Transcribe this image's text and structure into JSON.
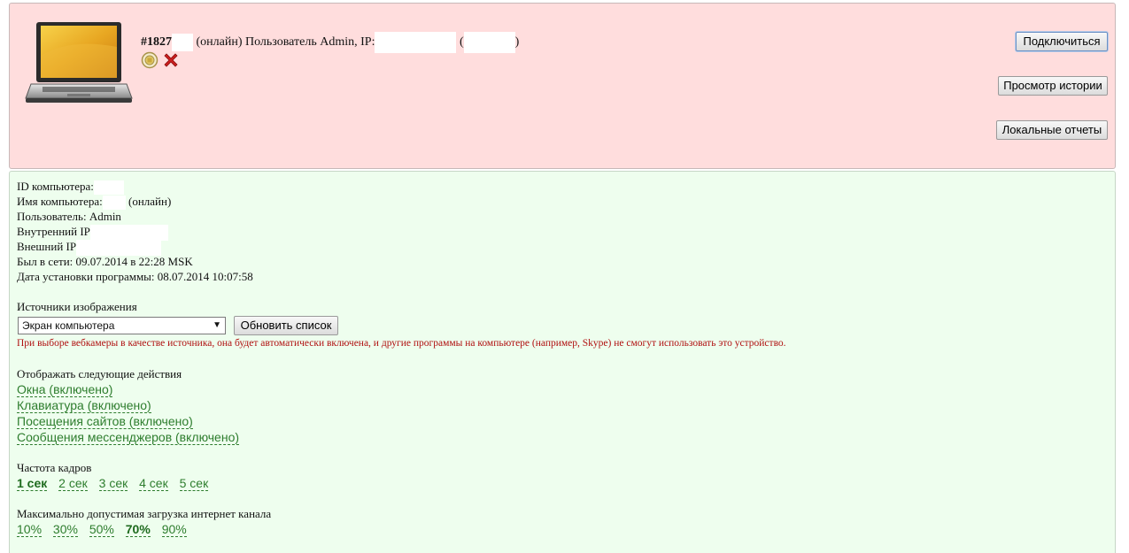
{
  "header": {
    "number": "#1827",
    "status_text": "(онлайн) Пользователь Admin, IP:",
    "open_paren": "(",
    "close_paren": ")"
  },
  "buttons": {
    "connect": "Подключиться",
    "history": "Просмотр истории",
    "reports": "Локальные отчеты"
  },
  "info": {
    "computer_id_label": "ID компьютера:",
    "computer_name_label": "Имя компьютера:",
    "computer_name_status": "(онлайн)",
    "user": "Пользователь: Admin",
    "internal_ip_label": "Внутренний IP",
    "external_ip_label": "Внешний IP",
    "last_seen": "Был в сети: 09.07.2014 в 22:28 MSK",
    "install_date": "Дата установки программы: 08.07.2014 10:07:58"
  },
  "image_sources": {
    "label": "Источники изображения",
    "selected": "Экран компьютера",
    "refresh_button": "Обновить список",
    "warning": "При выборе вебкамеры в качестве источника, она будет автоматически включена, и другие программы на компьютере (например, Skype) не смогут использовать это устройство."
  },
  "actions": {
    "label": "Отображать следующие действия",
    "items": [
      "Окна (включено)",
      "Клавиатура (включено)",
      "Посещения сайтов (включено)",
      "Сообщения мессенджеров (включено)"
    ]
  },
  "frame_rate": {
    "label": "Частота кадров",
    "options": [
      "1 сек",
      "2 сек",
      "3 сек",
      "4 сек",
      "5 сек"
    ],
    "selected": "1 сек"
  },
  "bandwidth": {
    "label": "Максимально допустимая загрузка интернет канала",
    "options": [
      "10%",
      "30%",
      "50%",
      "70%",
      "90%"
    ],
    "selected": "70%"
  },
  "colors": {
    "top_panel_bg": "#ffdddd",
    "info_panel_bg": "#eefeee",
    "link_green": "#2e7d2e",
    "warning_red": "#b01010"
  },
  "icons": {
    "computer": "laptop-icon",
    "status": "stop-circle-icon",
    "delete": "red-x-icon"
  }
}
